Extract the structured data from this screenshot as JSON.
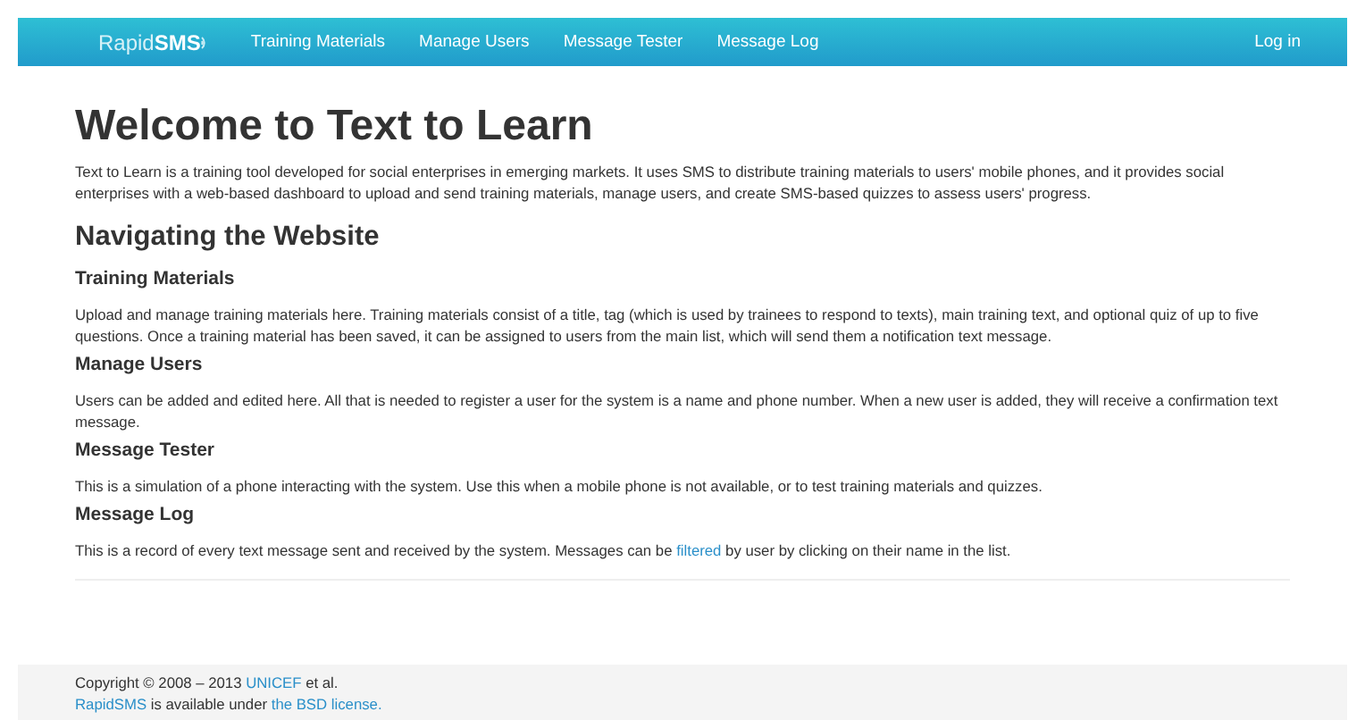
{
  "navbar": {
    "logo": {
      "light": "Rapid",
      "bold": "SMS"
    },
    "links": [
      "Training Materials",
      "Manage Users",
      "Message Tester",
      "Message Log"
    ],
    "login": "Log in"
  },
  "title": "Welcome to Text to Learn",
  "intro": "Text to Learn is a training tool developed for social enterprises in emerging markets. It uses SMS to distribute training materials to users' mobile phones, and it provides social enterprises with a web-based dashboard to upload and send training materials, manage users, and create SMS-based quizzes to assess users' progress.",
  "section_title": "Navigating the Website",
  "sections": [
    {
      "heading": "Training Materials",
      "text": [
        {
          "t": "Upload and manage training materials here. Training materials consist of a title, tag (which is used by trainees to respond to texts), main training text, and optional quiz of up to five questions. Once a training material has been saved, it can be assigned to users from the main list, which will send them a notification text message.",
          "link": false
        }
      ]
    },
    {
      "heading": "Manage Users",
      "text": [
        {
          "t": "Users can be added and edited here. All that is needed to register a user for the system is a name and phone number. When a new user is added, they will receive a confirmation text message.",
          "link": false
        }
      ]
    },
    {
      "heading": "Message Tester",
      "text": [
        {
          "t": "This is a simulation of a phone interacting with the system. Use this when a mobile phone is not available, or to test training materials and quizzes.",
          "link": false
        }
      ]
    },
    {
      "heading": "Message Log",
      "text": [
        {
          "t": "This is a record of every text message sent and received by the system. Messages can be ",
          "link": false
        },
        {
          "t": "filtered",
          "link": true
        },
        {
          "t": " by user by clicking on their name in the list.",
          "link": false
        }
      ]
    }
  ],
  "footer": [
    [
      {
        "t": "Copyright © 2008 – 2013 ",
        "link": false
      },
      {
        "t": "UNICEF",
        "link": true
      },
      {
        "t": " et al.",
        "link": false
      }
    ],
    [
      {
        "t": "RapidSMS",
        "link": true
      },
      {
        "t": " is available under ",
        "link": false
      },
      {
        "t": "the BSD license.",
        "link": true
      }
    ]
  ]
}
